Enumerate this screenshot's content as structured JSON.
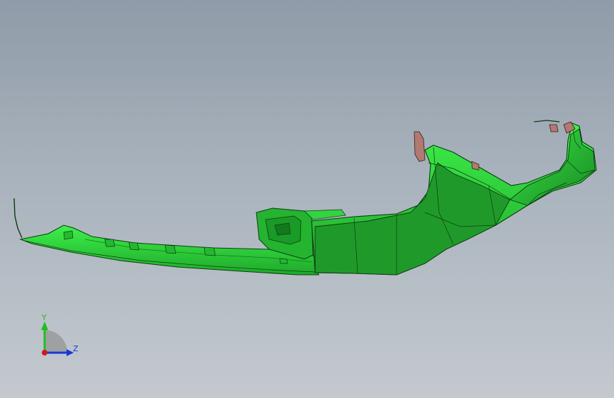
{
  "viewport": {
    "background_top": "#8f9ba8",
    "background_bottom": "#c4c9cf"
  },
  "model": {
    "part_color": "#2fdc3c",
    "part_dark_color": "#1f9a2a",
    "edge_color": "#0d3b10",
    "bracket_color": "#b07a72"
  },
  "triad": {
    "y_label": "Y",
    "z_label": "Z",
    "y_color": "#1fbf1f",
    "z_color": "#1a38d6",
    "x_color": "#d01a1a"
  }
}
